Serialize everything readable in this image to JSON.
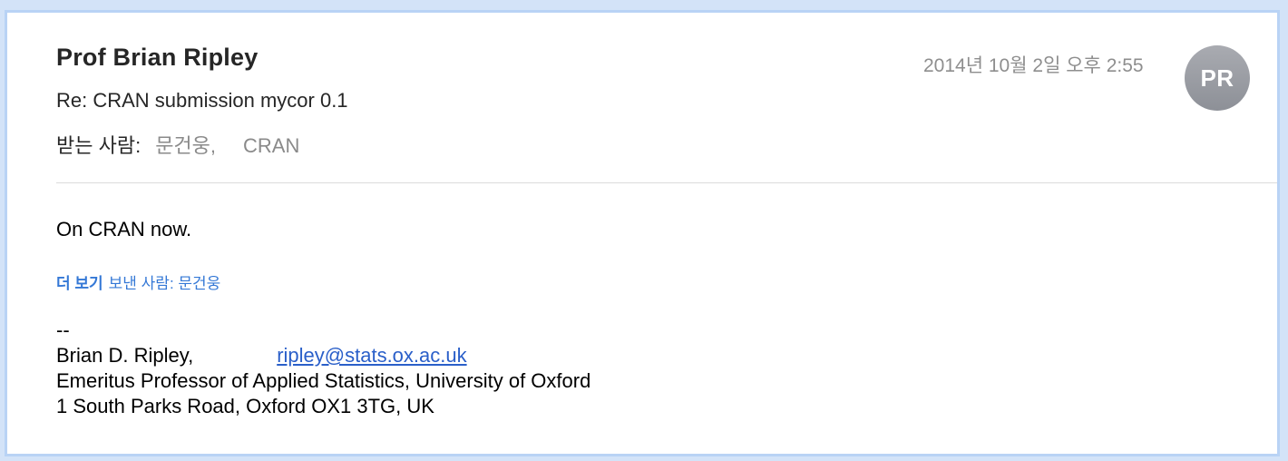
{
  "header": {
    "sender_name": "Prof Brian Ripley",
    "subject": "Re: CRAN submission mycor 0.1",
    "to_label": "받는 사람:",
    "recipients": [
      "문건웅,",
      "CRAN"
    ],
    "date": "2014년 10월 2일 오후 2:55",
    "avatar_initials": "PR"
  },
  "body": {
    "text": "On CRAN now.",
    "more_link": "더 보기",
    "more_suffix": "보낸 사람: 문건웅"
  },
  "signature": {
    "dashes": "--",
    "name": "Brian D. Ripley,",
    "email": "ripley@stats.ox.ac.uk",
    "title": "Emeritus Professor of Applied Statistics, University of Oxford",
    "address": "1 South Parks Road, Oxford OX1 3TG, UK"
  },
  "colors": {
    "link": "#2a5fc9",
    "accent": "#3478d6",
    "avatar": "#9a9ca2"
  }
}
